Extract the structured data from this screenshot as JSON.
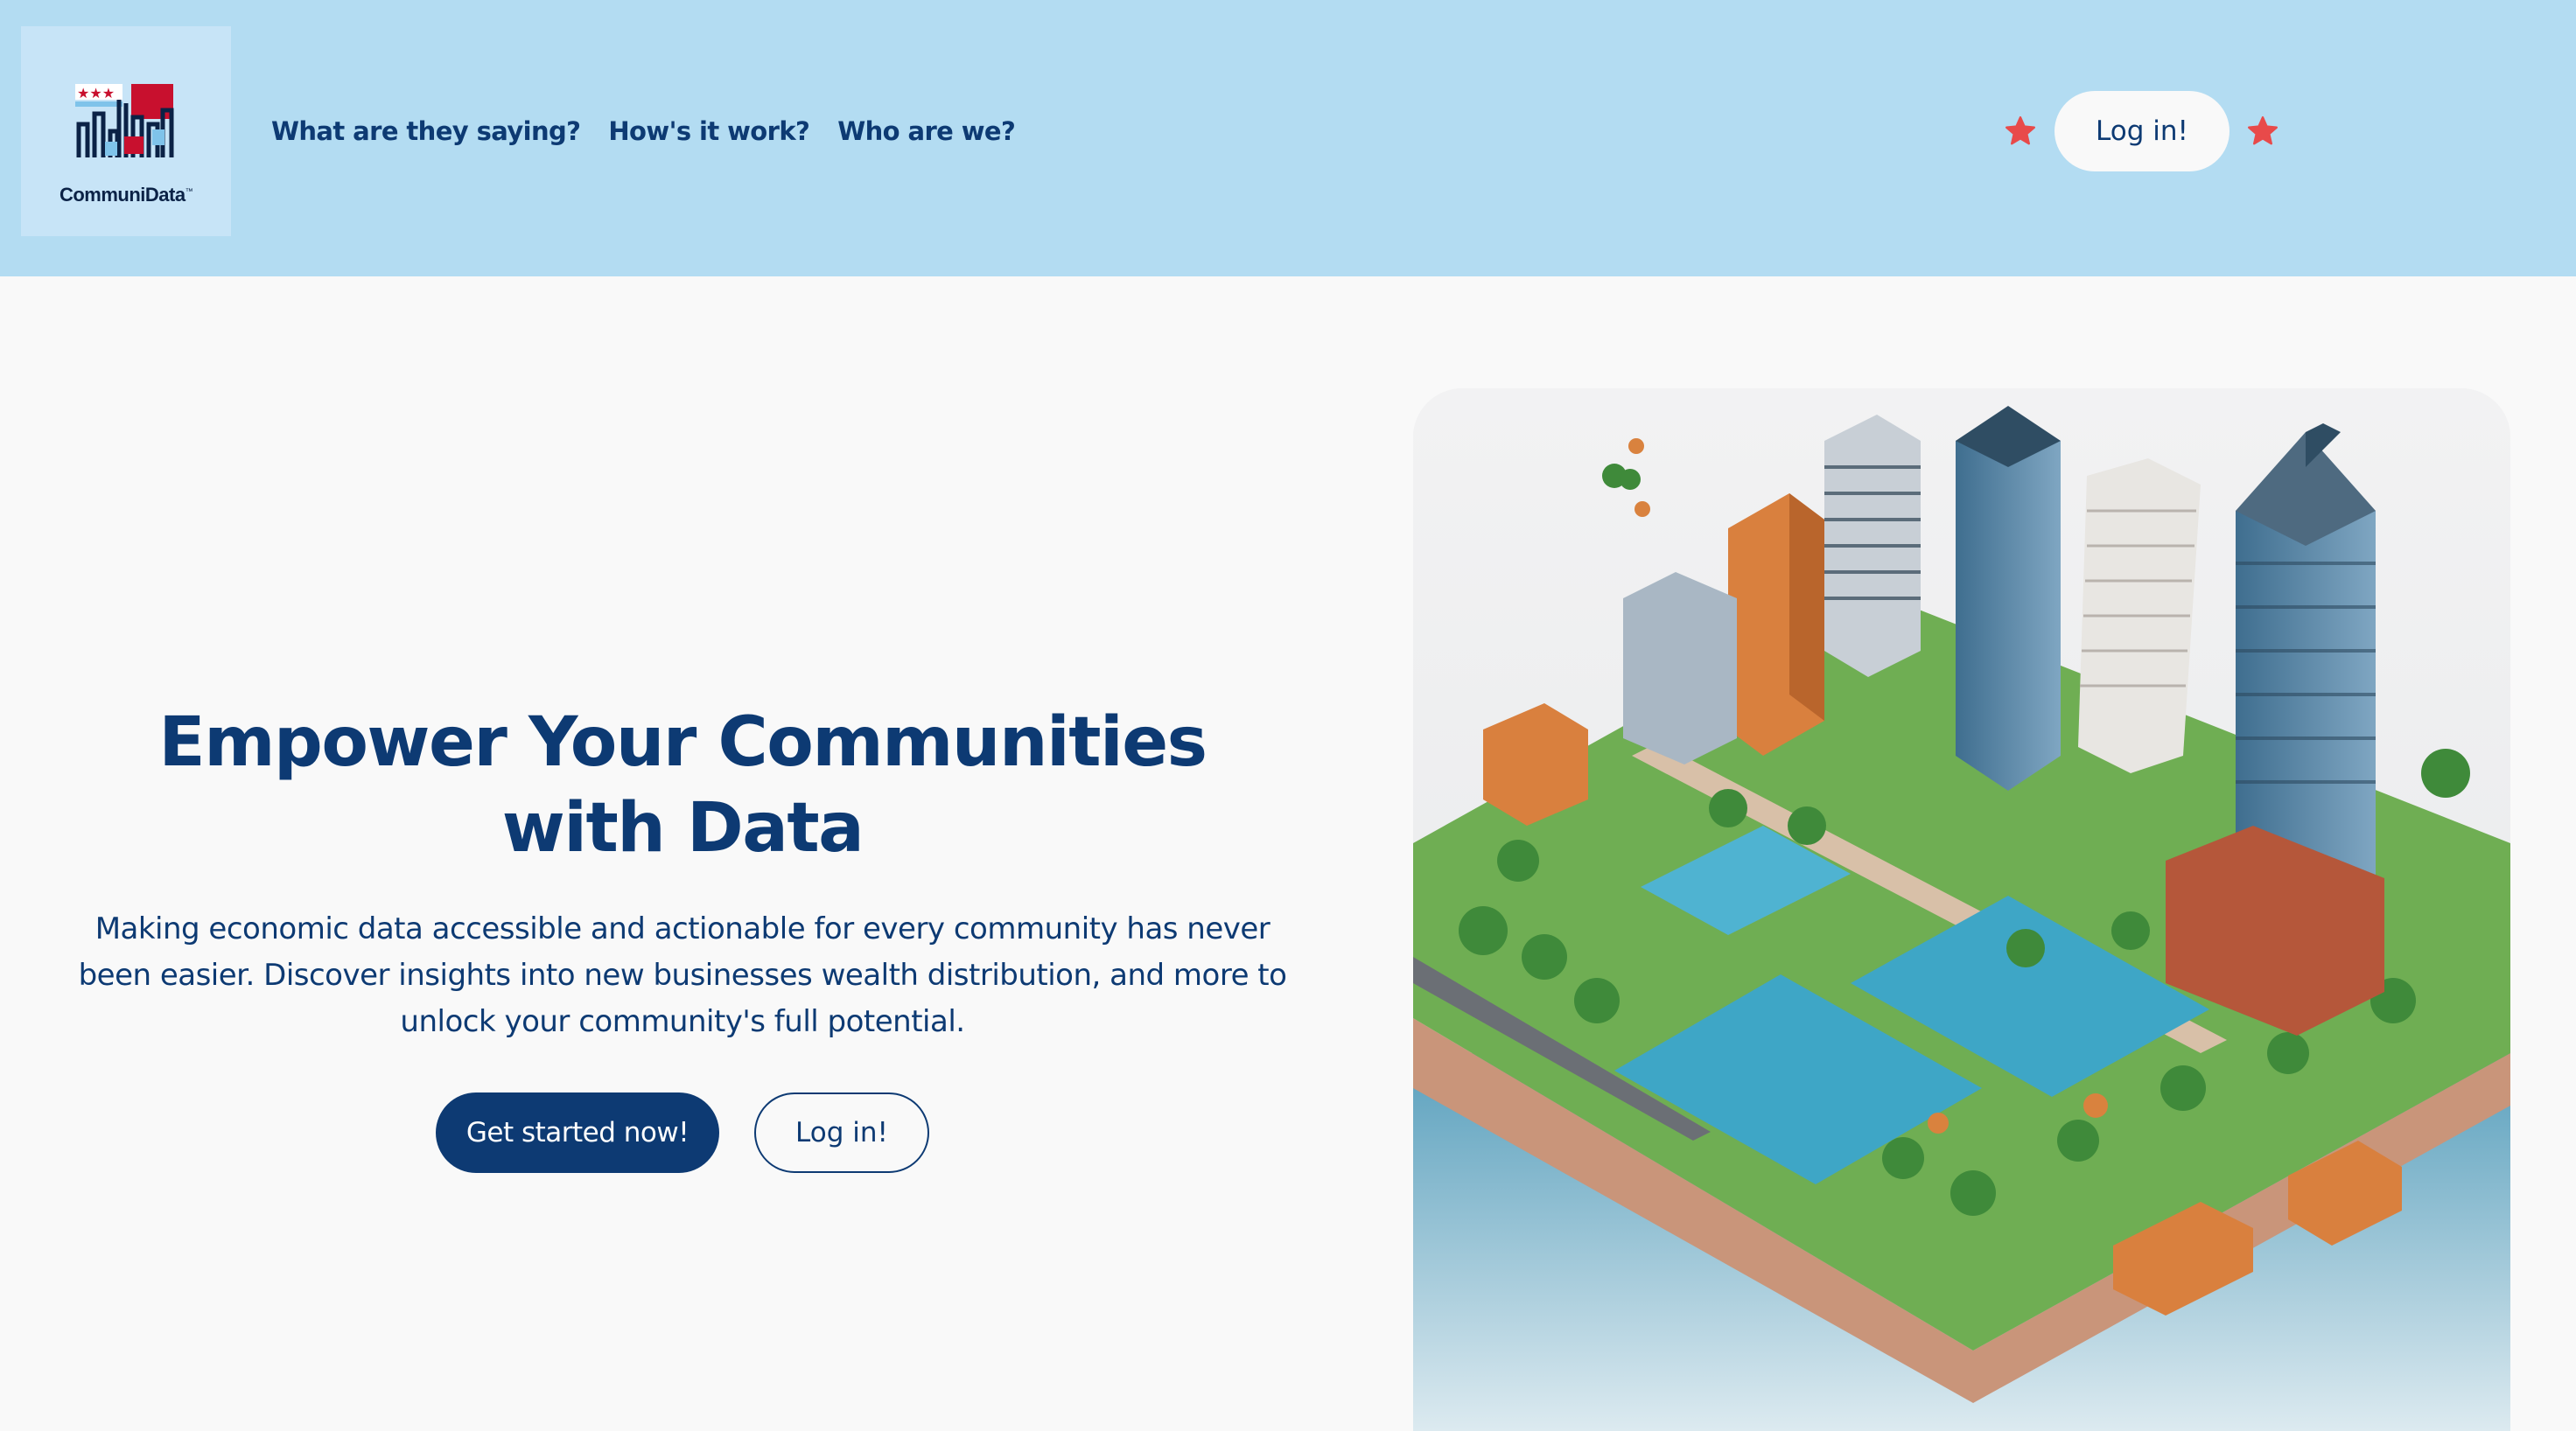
{
  "brand": {
    "name": "CommuniData",
    "trademark": "™"
  },
  "nav": {
    "items": [
      {
        "label": "What are they saying?"
      },
      {
        "label": "How's it work?"
      },
      {
        "label": "Who are we?"
      }
    ]
  },
  "header": {
    "login_label": "Log in!",
    "star_icon": "star-icon",
    "star_color": "#e84a4a"
  },
  "hero": {
    "title": "Empower Your Communities with Data",
    "subtitle": "Making economic data accessible and actionable for every community has never been easier. Discover insights into new businesses wealth distribution, and more to unlock your community's full potential.",
    "primary_button": "Get started now!",
    "secondary_button": "Log in!"
  },
  "colors": {
    "header_bg": "#b3dcf2",
    "page_bg": "#f9f9f9",
    "brand_navy": "#0d3a73",
    "accent_red": "#e84a4a"
  }
}
